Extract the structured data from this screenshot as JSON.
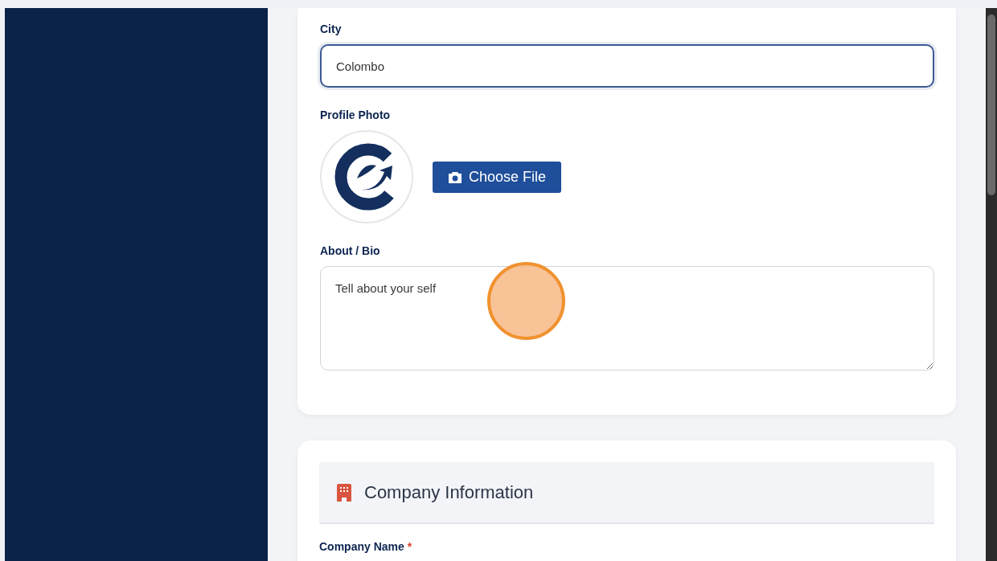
{
  "profile_form": {
    "fields": [
      {
        "kind": "text",
        "label": "City",
        "value": "Colombo",
        "focused": true
      },
      {
        "kind": "photo",
        "label": "Profile Photo",
        "button": "Choose File"
      },
      {
        "kind": "textarea",
        "label": "About / Bio",
        "placeholder": "Tell about your self",
        "focused": false
      }
    ]
  },
  "company_section": {
    "title": "Company Information",
    "fields": [
      {
        "label": "Company Name",
        "required": true,
        "required_mark": "*"
      }
    ]
  }
}
